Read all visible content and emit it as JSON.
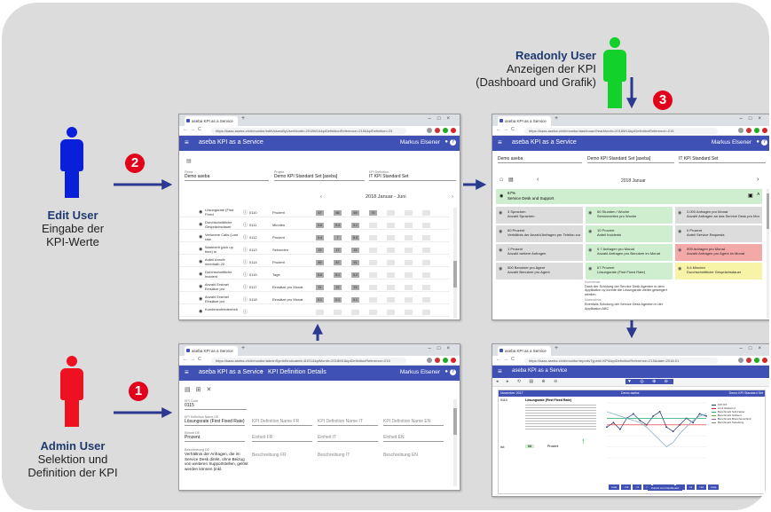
{
  "labels": {
    "edit": {
      "title": "Edit User",
      "line1": "Eingabe der",
      "line2": "KPI-Werte",
      "badge": "2"
    },
    "readonly": {
      "title": "Readonly User",
      "line1": "Anzeigen der KPI",
      "line2": "(Dashboard und Grafik)",
      "badge": "3"
    },
    "admin": {
      "title": "Admin User",
      "line1": "Selektion und",
      "line2": "Definition der KPI",
      "badge": "1"
    }
  },
  "colors": {
    "edit": "#0a1fd9",
    "readonly": "#12d12a",
    "admin": "#ee1122",
    "arrow": "#2b3990",
    "badge": "#e2001a",
    "appbar": "#3f51b5"
  },
  "win_edit": {
    "tab": "aseba KPI as a Service",
    "url": "https://kaas.aseba.ch/#/monitor/editValuesByUserMonth=2018M1&kpiDefinitionReference=215&kpiDefinition=23",
    "app_title": "aseba KPI as a Service",
    "user": "Markus Elsener",
    "firma_label": "Firma",
    "firma": "Demo aseba",
    "projekt_label": "Projekt",
    "projekt": "Demo KPI Standard Set [aseba]",
    "kpi_label": "KPI Definition",
    "kpi": "IT KPI Standard Set",
    "period": "2018 Januar - Juni",
    "rows": [
      {
        "name": "Lösungsrate (First Fixed",
        "code": "0110",
        "unit": "Prozent",
        "vals": [
          "67",
          "66",
          "69",
          "70"
        ]
      },
      {
        "name": "Durchschnittliche Gesprächsdauer",
        "code": "0111",
        "unit": "Minuten",
        "vals": [
          "9.6",
          "9.4",
          "9.1",
          ""
        ]
      },
      {
        "name": "Verlorene Calls (Lost rate",
        "code": "0112",
        "unit": "Prozent",
        "vals": [
          "9.4",
          "7",
          "8.3",
          ""
        ]
      },
      {
        "name": "Wartezeit (pick up time) in",
        "code": "0113",
        "unit": "Sekunden",
        "vals": [
          "19",
          "17",
          "15",
          ""
        ]
      },
      {
        "name": "Anteil Anrufe innerhalb 20",
        "code": "0114",
        "unit": "Prozent",
        "vals": [
          "89",
          "87",
          "91",
          ""
        ]
      },
      {
        "name": "Durchschnittliche Incident",
        "code": "0115",
        "unit": "Tage",
        "vals": [
          "5.6",
          "5.1",
          "5.2",
          ""
        ]
      },
      {
        "name": "Anzahl Erstmel Einsätze pro",
        "code": "0117",
        "unit": "Einsätze pro Monat",
        "vals": [
          "21",
          "22",
          "23",
          ""
        ]
      },
      {
        "name": "Anzahl Erstmel Einsätze pro",
        "code": "0118",
        "unit": "Einsätze pro Monat",
        "vals": [
          "0.1",
          "0.1",
          "0.1",
          ""
        ]
      },
      {
        "name": "Kundenzufriedenheit",
        "code": "",
        "unit": "",
        "vals": [
          "",
          "",
          "",
          ""
        ]
      }
    ]
  },
  "win_admin": {
    "tab": "aseba KPI as a Service",
    "url": "https://kaas.aseba.ch/#/monitor/adminSymbKindicateid=81S1&kpiMonth=2018M1&kpiDefinitionReference=215",
    "app_title": "aseba KPI as a Service",
    "breadcrumb": "KPI Definition Details",
    "user": "Markus Elsener",
    "kpi_code_label": "KPI Code",
    "kpi_code": "0115",
    "kpi_name_label": "KPI Definition Name DE",
    "kpi_name": "Lösungsrate (First Fixed Rate)",
    "name_fr": "KPI Definition Name FR",
    "name_it": "KPI Definition Name IT",
    "name_en": "KPI Definition Name EN",
    "unit_label": "Einheit DE",
    "unit": "Prozent",
    "unit_fr": "Einheit FR",
    "unit_it": "Einheit IT",
    "unit_en": "Einheit EN",
    "desc_label": "Beschreibung DE",
    "desc": "Verhältnis der Anfragen, die im Service Desk direkt, ohne Beizug von weiteren Supportstellen, gelöst werden können (inkl.",
    "desc_fr": "Beschreibung FR",
    "desc_it": "Beschreibung IT",
    "desc_en": "Beschreibung EN"
  },
  "win_dash": {
    "tab": "aseba KPI as a Service",
    "url": "https://kaas.aseba.ch/#/monitor/dashboardYearMonth=2018M1&kpiDefinitionReference=215",
    "app_title": "aseba KPI as a Service",
    "user": "Markus Elsener",
    "firma": "Demo aseba",
    "projekt": "Demo KPI Standard Set [aseba]",
    "kpi": "IT KPI Standard Set",
    "period": "2018 Januar",
    "group_pct": "67%",
    "group": "Service Desk und Support",
    "tiles": [
      {
        "t1": "3 Sprachen",
        "t2": "Anzahl Sprachen",
        "c": "#dcdcdc"
      },
      {
        "t1": "50 Stunden / Woche",
        "t2": "Servicezeiten pro Woche",
        "c": "#cfeecf"
      },
      {
        "t1": "2.000 Anfragen pro Monat",
        "t2": "Anzahl Anfragen an das Service Desk pro Monat",
        "c": "#dcdcdc"
      },
      {
        "t1": "60 Prozent",
        "t2": "Verhältnis der Anzahl Anfragen per Telefon zur Anzahl Anfragen per",
        "c": "#dcdcdc"
      },
      {
        "t1": "10 Prozent",
        "t2": "Anteil Incidents",
        "c": "#cfeecf"
      },
      {
        "t1": "0 Prozent",
        "t2": "Anteil Service Requests",
        "c": "#dcdcdc"
      },
      {
        "t1": "1 Prozent",
        "t2": "Anzahl weitere Anfragen",
        "c": "#dcdcdc"
      },
      {
        "t1": "0.7 Anfragen pro Monat",
        "t2": "Anzahl Anfragen pro Benutzer im Monat",
        "c": "#cfeecf"
      },
      {
        "t1": "005 Anfragen pro Monat",
        "t2": "Anzahl Anfragen pro Agent im Monat",
        "c": "#f4a9a9"
      },
      {
        "t1": "500 Benutzer pro Agent",
        "t2": "Anzahl Benutzer pro Agent",
        "c": "#dcdcdc"
      },
      {
        "t1": "67 Prozent",
        "t2": "Lösungsrate (First Fixed Rate)",
        "c": "#cfeecf"
      },
      {
        "t1": "5,6 Minuten",
        "t2": "Durchschnittliche Gesprächsdauer",
        "c": "#f7f4a8"
      }
    ],
    "comment_label": "Kommentar",
    "comment": "Dank der Schulung der Service Desk Agenten in dem Applikation xy konnte die Lösungsrate weiter gesteigert werden.",
    "measure_label": "Massnahme",
    "measure": "Ebenfalls Schulung der Service Desk Agenten in der Applikation ABC"
  },
  "win_chart": {
    "tab": "aseba KPI as a Service",
    "url": "https://kaas.aseba.ch/#/monitor/reportsTypeId=KPI&kpiDefinitionReference=215&date=2018-01",
    "app_title": "aseba KPI as a Service",
    "report_month": "November 2017",
    "report_title": "Demo aseba",
    "report_right": "Demo KPI Standard Set",
    "kpi_code": "0110",
    "kpi_name": "Lösungsrate (First Fixed Rate)",
    "ist_label": "Ist:",
    "ist": "68",
    "unit": "Prozent",
    "legend": [
      "KPI IST",
      "Limit Wellennd",
      "Benchmark Soll-Fieber",
      "Benchmark Sollwert",
      "Benchmark Branchenschnitt",
      "Benchmark Verteilung"
    ],
    "buttons": [
      "Liste",
      "<12",
      "<3",
      "<1",
      "Alle Perioden",
      ">1",
      ">3",
      ">12",
      "Liste"
    ],
    "back": "Zurück zum Dashboard",
    "chart_data": {
      "type": "line",
      "series": [
        {
          "name": "KPI IST",
          "values": [
            58,
            62,
            56,
            66,
            70,
            64,
            60,
            68,
            72,
            58,
            54,
            60,
            66,
            62,
            70,
            68
          ]
        },
        {
          "values": [
            60,
            60,
            60,
            60,
            60,
            60,
            60,
            60,
            60,
            60,
            60,
            60,
            60,
            60,
            60,
            60
          ]
        },
        {
          "values": [
            66,
            66,
            66,
            66,
            66,
            66,
            66,
            66,
            66,
            66,
            66,
            66,
            66,
            66,
            66,
            66
          ]
        },
        {
          "values": [
            72,
            70,
            68,
            66,
            64,
            62,
            58,
            52,
            46,
            40,
            44,
            52,
            58,
            64,
            68,
            70
          ]
        }
      ],
      "ylim": [
        30,
        80
      ]
    }
  }
}
